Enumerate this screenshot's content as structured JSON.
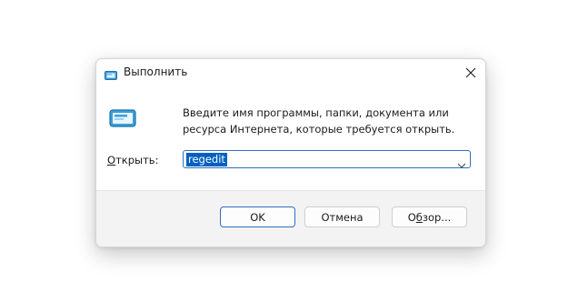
{
  "window": {
    "title": "Выполнить",
    "icon": "run-icon",
    "close_icon": "close-icon"
  },
  "content": {
    "icon": "run-icon",
    "description": "Введите имя программы, папки, документа или ресурса Интернета, которые требуется открыть.",
    "open_label_accel": "О",
    "open_label_rest": "ткрыть:",
    "input_value": "regedit"
  },
  "buttons": {
    "ok_label": "OK",
    "cancel_label": "Отмена",
    "browse_accel": "б",
    "browse_pre": "О",
    "browse_post": "зор..."
  },
  "colors": {
    "accent": "#0060c0",
    "focus_border": "#2f6fbf",
    "footer_bg": "#f3f3f3"
  }
}
